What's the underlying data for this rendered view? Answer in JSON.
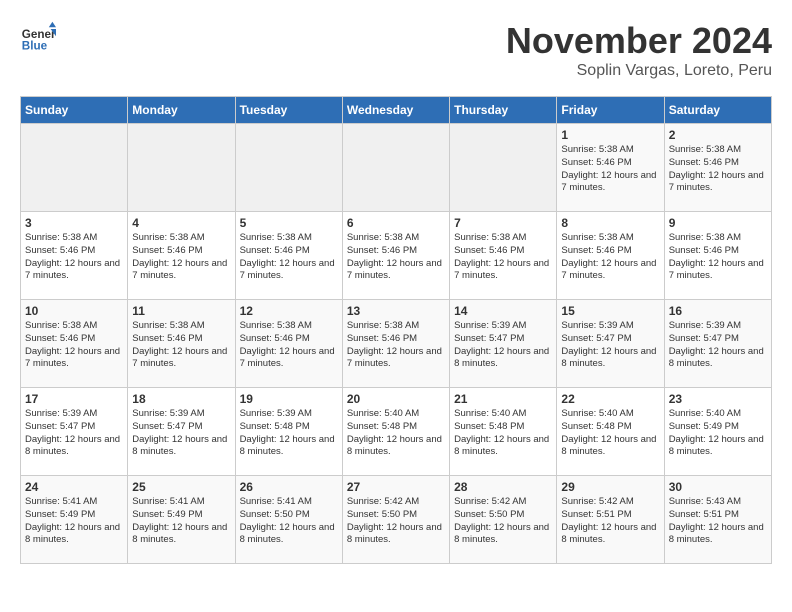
{
  "header": {
    "logo_line1": "General",
    "logo_line2": "Blue",
    "month_title": "November 2024",
    "location": "Soplin Vargas, Loreto, Peru"
  },
  "weekdays": [
    "Sunday",
    "Monday",
    "Tuesday",
    "Wednesday",
    "Thursday",
    "Friday",
    "Saturday"
  ],
  "weeks": [
    [
      {
        "day": "",
        "empty": true
      },
      {
        "day": "",
        "empty": true
      },
      {
        "day": "",
        "empty": true
      },
      {
        "day": "",
        "empty": true
      },
      {
        "day": "",
        "empty": true
      },
      {
        "day": "1",
        "sunrise": "5:38 AM",
        "sunset": "5:46 PM",
        "daylight": "12 hours and 7 minutes."
      },
      {
        "day": "2",
        "sunrise": "5:38 AM",
        "sunset": "5:46 PM",
        "daylight": "12 hours and 7 minutes."
      }
    ],
    [
      {
        "day": "3",
        "sunrise": "5:38 AM",
        "sunset": "5:46 PM",
        "daylight": "12 hours and 7 minutes."
      },
      {
        "day": "4",
        "sunrise": "5:38 AM",
        "sunset": "5:46 PM",
        "daylight": "12 hours and 7 minutes."
      },
      {
        "day": "5",
        "sunrise": "5:38 AM",
        "sunset": "5:46 PM",
        "daylight": "12 hours and 7 minutes."
      },
      {
        "day": "6",
        "sunrise": "5:38 AM",
        "sunset": "5:46 PM",
        "daylight": "12 hours and 7 minutes."
      },
      {
        "day": "7",
        "sunrise": "5:38 AM",
        "sunset": "5:46 PM",
        "daylight": "12 hours and 7 minutes."
      },
      {
        "day": "8",
        "sunrise": "5:38 AM",
        "sunset": "5:46 PM",
        "daylight": "12 hours and 7 minutes."
      },
      {
        "day": "9",
        "sunrise": "5:38 AM",
        "sunset": "5:46 PM",
        "daylight": "12 hours and 7 minutes."
      }
    ],
    [
      {
        "day": "10",
        "sunrise": "5:38 AM",
        "sunset": "5:46 PM",
        "daylight": "12 hours and 7 minutes."
      },
      {
        "day": "11",
        "sunrise": "5:38 AM",
        "sunset": "5:46 PM",
        "daylight": "12 hours and 7 minutes."
      },
      {
        "day": "12",
        "sunrise": "5:38 AM",
        "sunset": "5:46 PM",
        "daylight": "12 hours and 7 minutes."
      },
      {
        "day": "13",
        "sunrise": "5:38 AM",
        "sunset": "5:46 PM",
        "daylight": "12 hours and 7 minutes."
      },
      {
        "day": "14",
        "sunrise": "5:39 AM",
        "sunset": "5:47 PM",
        "daylight": "12 hours and 8 minutes."
      },
      {
        "day": "15",
        "sunrise": "5:39 AM",
        "sunset": "5:47 PM",
        "daylight": "12 hours and 8 minutes."
      },
      {
        "day": "16",
        "sunrise": "5:39 AM",
        "sunset": "5:47 PM",
        "daylight": "12 hours and 8 minutes."
      }
    ],
    [
      {
        "day": "17",
        "sunrise": "5:39 AM",
        "sunset": "5:47 PM",
        "daylight": "12 hours and 8 minutes."
      },
      {
        "day": "18",
        "sunrise": "5:39 AM",
        "sunset": "5:47 PM",
        "daylight": "12 hours and 8 minutes."
      },
      {
        "day": "19",
        "sunrise": "5:39 AM",
        "sunset": "5:48 PM",
        "daylight": "12 hours and 8 minutes."
      },
      {
        "day": "20",
        "sunrise": "5:40 AM",
        "sunset": "5:48 PM",
        "daylight": "12 hours and 8 minutes."
      },
      {
        "day": "21",
        "sunrise": "5:40 AM",
        "sunset": "5:48 PM",
        "daylight": "12 hours and 8 minutes."
      },
      {
        "day": "22",
        "sunrise": "5:40 AM",
        "sunset": "5:48 PM",
        "daylight": "12 hours and 8 minutes."
      },
      {
        "day": "23",
        "sunrise": "5:40 AM",
        "sunset": "5:49 PM",
        "daylight": "12 hours and 8 minutes."
      }
    ],
    [
      {
        "day": "24",
        "sunrise": "5:41 AM",
        "sunset": "5:49 PM",
        "daylight": "12 hours and 8 minutes."
      },
      {
        "day": "25",
        "sunrise": "5:41 AM",
        "sunset": "5:49 PM",
        "daylight": "12 hours and 8 minutes."
      },
      {
        "day": "26",
        "sunrise": "5:41 AM",
        "sunset": "5:50 PM",
        "daylight": "12 hours and 8 minutes."
      },
      {
        "day": "27",
        "sunrise": "5:42 AM",
        "sunset": "5:50 PM",
        "daylight": "12 hours and 8 minutes."
      },
      {
        "day": "28",
        "sunrise": "5:42 AM",
        "sunset": "5:50 PM",
        "daylight": "12 hours and 8 minutes."
      },
      {
        "day": "29",
        "sunrise": "5:42 AM",
        "sunset": "5:51 PM",
        "daylight": "12 hours and 8 minutes."
      },
      {
        "day": "30",
        "sunrise": "5:43 AM",
        "sunset": "5:51 PM",
        "daylight": "12 hours and 8 minutes."
      }
    ]
  ],
  "labels": {
    "sunrise": "Sunrise:",
    "sunset": "Sunset:",
    "daylight": "Daylight:"
  }
}
